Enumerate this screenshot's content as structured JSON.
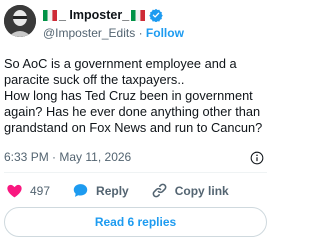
{
  "user": {
    "display_name": "_ Imposter_",
    "handle": "@Imposter_Edits",
    "separator": "·",
    "follow_label": "Follow"
  },
  "tweet": {
    "text": "So AoC is a government employee and a\nparacite suck off the taxpayers..\nHow long has Ted Cruz been in government\nagain? Has he ever done anything other than\ngrandstand on Fox News and run to Cancun?",
    "time": "6:33 PM",
    "date": "May 11, 2026",
    "meta_separator": "·"
  },
  "actions": {
    "likes": "497",
    "reply_label": "Reply",
    "copy_link_label": "Copy link"
  },
  "read_replies_label": "Read 6 replies",
  "icons": {
    "like": "heart-icon",
    "reply": "reply-bubble-icon",
    "copy": "link-icon",
    "verified": "verified-badge-icon",
    "info": "info-icon",
    "brand": "bird-logo-icon",
    "more": "more-dots-icon",
    "flag": "italy-flag-icon"
  },
  "colors": {
    "accent": "#1d9bf0",
    "like": "#f91880",
    "secondary_text": "#536471",
    "primary_text": "#0f1419"
  }
}
